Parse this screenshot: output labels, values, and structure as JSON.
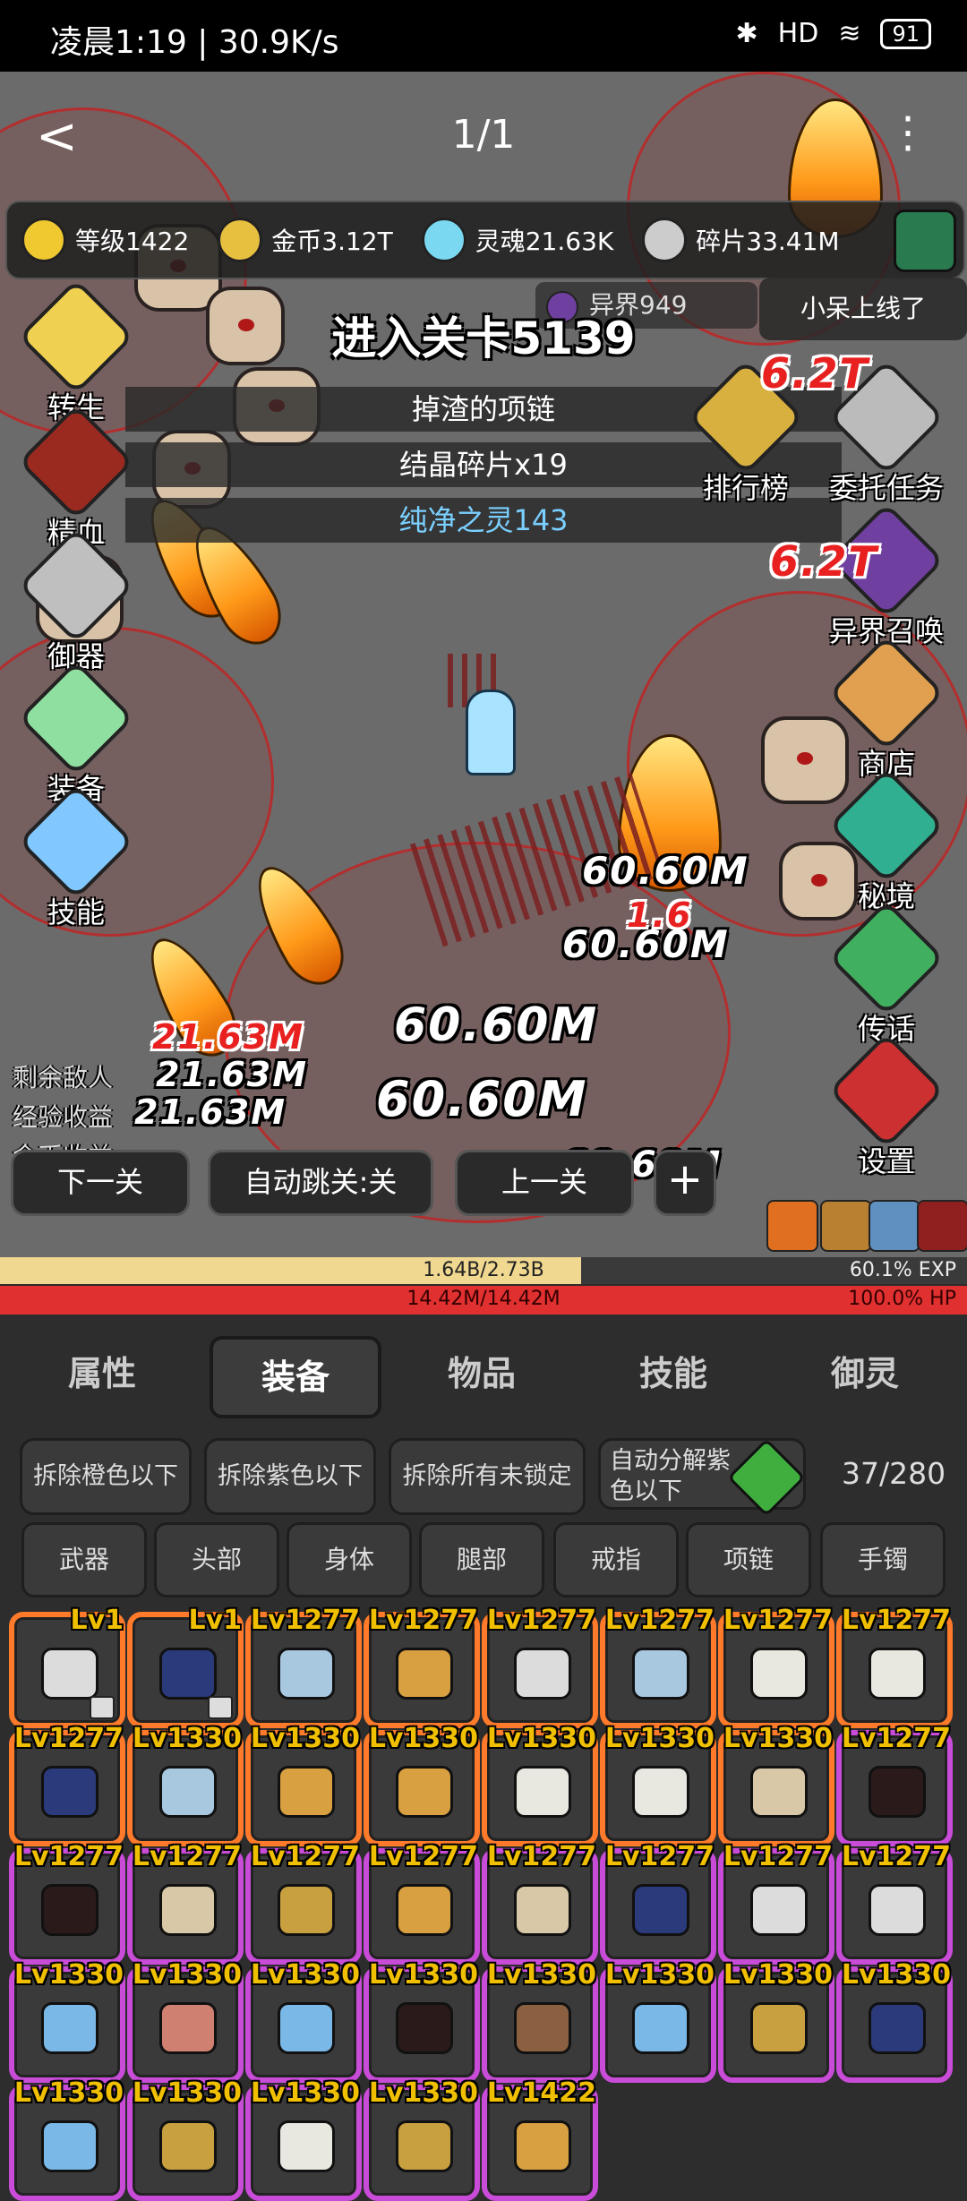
{
  "status_bar": {
    "time_speed": "凌晨1:19 | 30.9K/s",
    "battery": "91",
    "network": "HD"
  },
  "top_nav": {
    "back": "<",
    "page": "1/1",
    "more": "⋮"
  },
  "resources": [
    {
      "label": "等级1422",
      "color": "#f0c830"
    },
    {
      "label": "金币3.12T",
      "color": "#e8c040"
    },
    {
      "label": "灵魂21.63K",
      "color": "#7ad8f0"
    },
    {
      "label": "碎片33.41M",
      "color": "#cccccc"
    }
  ],
  "portal_tag": "异界949",
  "online_tag": "小呆上线了",
  "level": {
    "title": "进入关卡5139"
  },
  "drops": [
    "掉渣的项链",
    "结晶碎片x19",
    "纯净之灵143"
  ],
  "left_menu": [
    {
      "label": "转生",
      "color": "#f0d050"
    },
    {
      "label": "精血",
      "color": "#9a2a20"
    },
    {
      "label": "御器",
      "color": "#bfbfbf"
    },
    {
      "label": "装备",
      "color": "#8fe0a0"
    },
    {
      "label": "技能",
      "color": "#80c8ff"
    }
  ],
  "right_menu": [
    {
      "label": "排行榜",
      "color": "#d8b040"
    },
    {
      "label": "委托任务",
      "color": "#bbbbbb"
    },
    {
      "label": "异界召唤",
      "color": "#7040a0"
    },
    {
      "label": "商店",
      "color": "#e0a050"
    },
    {
      "label": "秘境",
      "color": "#30b090"
    },
    {
      "label": "传话",
      "color": "#40b060"
    },
    {
      "label": "设置",
      "color": "#cc3030"
    }
  ],
  "damage_texts": [
    "60.60M",
    "60.60M",
    "60.60M",
    "60.60M",
    "60.60M",
    "21.63M",
    "21.63M",
    "21.63M",
    "6.2T",
    "6.2T",
    "1.6"
  ],
  "remain_labels": [
    "剩余敌人",
    "经验收益",
    "金币收益"
  ],
  "controls": {
    "next": "下一关",
    "auto": "自动跳关:关",
    "prev": "上一关",
    "plus": "+"
  },
  "exp": {
    "text": "1.64B/2.73B",
    "percent": "60.1% EXP",
    "fill": 0.601
  },
  "hp": {
    "text": "14.42M/14.42M",
    "percent": "100.0%  HP",
    "fill": 1.0
  },
  "tabs": [
    "属性",
    "装备",
    "物品",
    "技能",
    "御灵"
  ],
  "active_tab": 1,
  "dismantle": [
    "拆除橙色以下",
    "拆除紫色以下",
    "拆除所有未锁定",
    "自动分解紫色以下"
  ],
  "inventory_count": "37/280",
  "slot_filters": [
    "武器",
    "头部",
    "身体",
    "腿部",
    "戒指",
    "项链",
    "手镯"
  ],
  "items": [
    {
      "lv": "Lv1",
      "rarity": "orange",
      "icon": "sword",
      "locked": true
    },
    {
      "lv": "Lv1",
      "rarity": "orange",
      "icon": "boots",
      "locked": true
    },
    {
      "lv": "Lv1277",
      "rarity": "orange",
      "icon": "armor"
    },
    {
      "lv": "Lv1277",
      "rarity": "orange",
      "icon": "helmet"
    },
    {
      "lv": "Lv1277",
      "rarity": "orange",
      "icon": "sword"
    },
    {
      "lv": "Lv1277",
      "rarity": "orange",
      "icon": "armor"
    },
    {
      "lv": "Lv1277",
      "rarity": "orange",
      "icon": "hat"
    },
    {
      "lv": "Lv1277",
      "rarity": "orange",
      "icon": "hat"
    },
    {
      "lv": "Lv1277",
      "rarity": "orange",
      "icon": "boots"
    },
    {
      "lv": "Lv1330",
      "rarity": "orange",
      "icon": "armor"
    },
    {
      "lv": "Lv1330",
      "rarity": "orange",
      "icon": "helmet"
    },
    {
      "lv": "Lv1330",
      "rarity": "orange",
      "icon": "helmet"
    },
    {
      "lv": "Lv1330",
      "rarity": "orange",
      "icon": "hat"
    },
    {
      "lv": "Lv1330",
      "rarity": "orange",
      "icon": "hat"
    },
    {
      "lv": "Lv1330",
      "rarity": "orange",
      "icon": "chest"
    },
    {
      "lv": "Lv1277",
      "rarity": "purple",
      "icon": "necklace"
    },
    {
      "lv": "Lv1277",
      "rarity": "purple",
      "icon": "necklace"
    },
    {
      "lv": "Lv1277",
      "rarity": "purple",
      "icon": "chest"
    },
    {
      "lv": "Lv1277",
      "rarity": "purple",
      "icon": "ring"
    },
    {
      "lv": "Lv1277",
      "rarity": "purple",
      "icon": "helmet"
    },
    {
      "lv": "Lv1277",
      "rarity": "purple",
      "icon": "chest"
    },
    {
      "lv": "Lv1277",
      "rarity": "purple",
      "icon": "boots"
    },
    {
      "lv": "Lv1277",
      "rarity": "purple",
      "icon": "sword"
    },
    {
      "lv": "Lv1277",
      "rarity": "purple",
      "icon": "sword"
    },
    {
      "lv": "Lv1330",
      "rarity": "purple",
      "icon": "bracelet"
    },
    {
      "lv": "Lv1330",
      "rarity": "purple",
      "icon": "hammer"
    },
    {
      "lv": "Lv1330",
      "rarity": "purple",
      "icon": "bracelet"
    },
    {
      "lv": "Lv1330",
      "rarity": "purple",
      "icon": "necklace"
    },
    {
      "lv": "Lv1330",
      "rarity": "purple",
      "icon": "bow"
    },
    {
      "lv": "Lv1330",
      "rarity": "purple",
      "icon": "bracelet"
    },
    {
      "lv": "Lv1330",
      "rarity": "purple",
      "icon": "ring"
    },
    {
      "lv": "Lv1330",
      "rarity": "purple",
      "icon": "boots"
    },
    {
      "lv": "Lv1330",
      "rarity": "purple",
      "icon": "bracelet"
    },
    {
      "lv": "Lv1330",
      "rarity": "purple",
      "icon": "ring"
    },
    {
      "lv": "Lv1330",
      "rarity": "purple",
      "icon": "hat"
    },
    {
      "lv": "Lv1330",
      "rarity": "purple",
      "icon": "ring"
    },
    {
      "lv": "Lv1422",
      "rarity": "purple",
      "icon": "helmet"
    }
  ],
  "colors": {
    "orange": "#ff7a2a",
    "purple": "#c84cd8",
    "level_text": "#f0c000",
    "exp": "#f0d890",
    "hp": "#e03030"
  }
}
